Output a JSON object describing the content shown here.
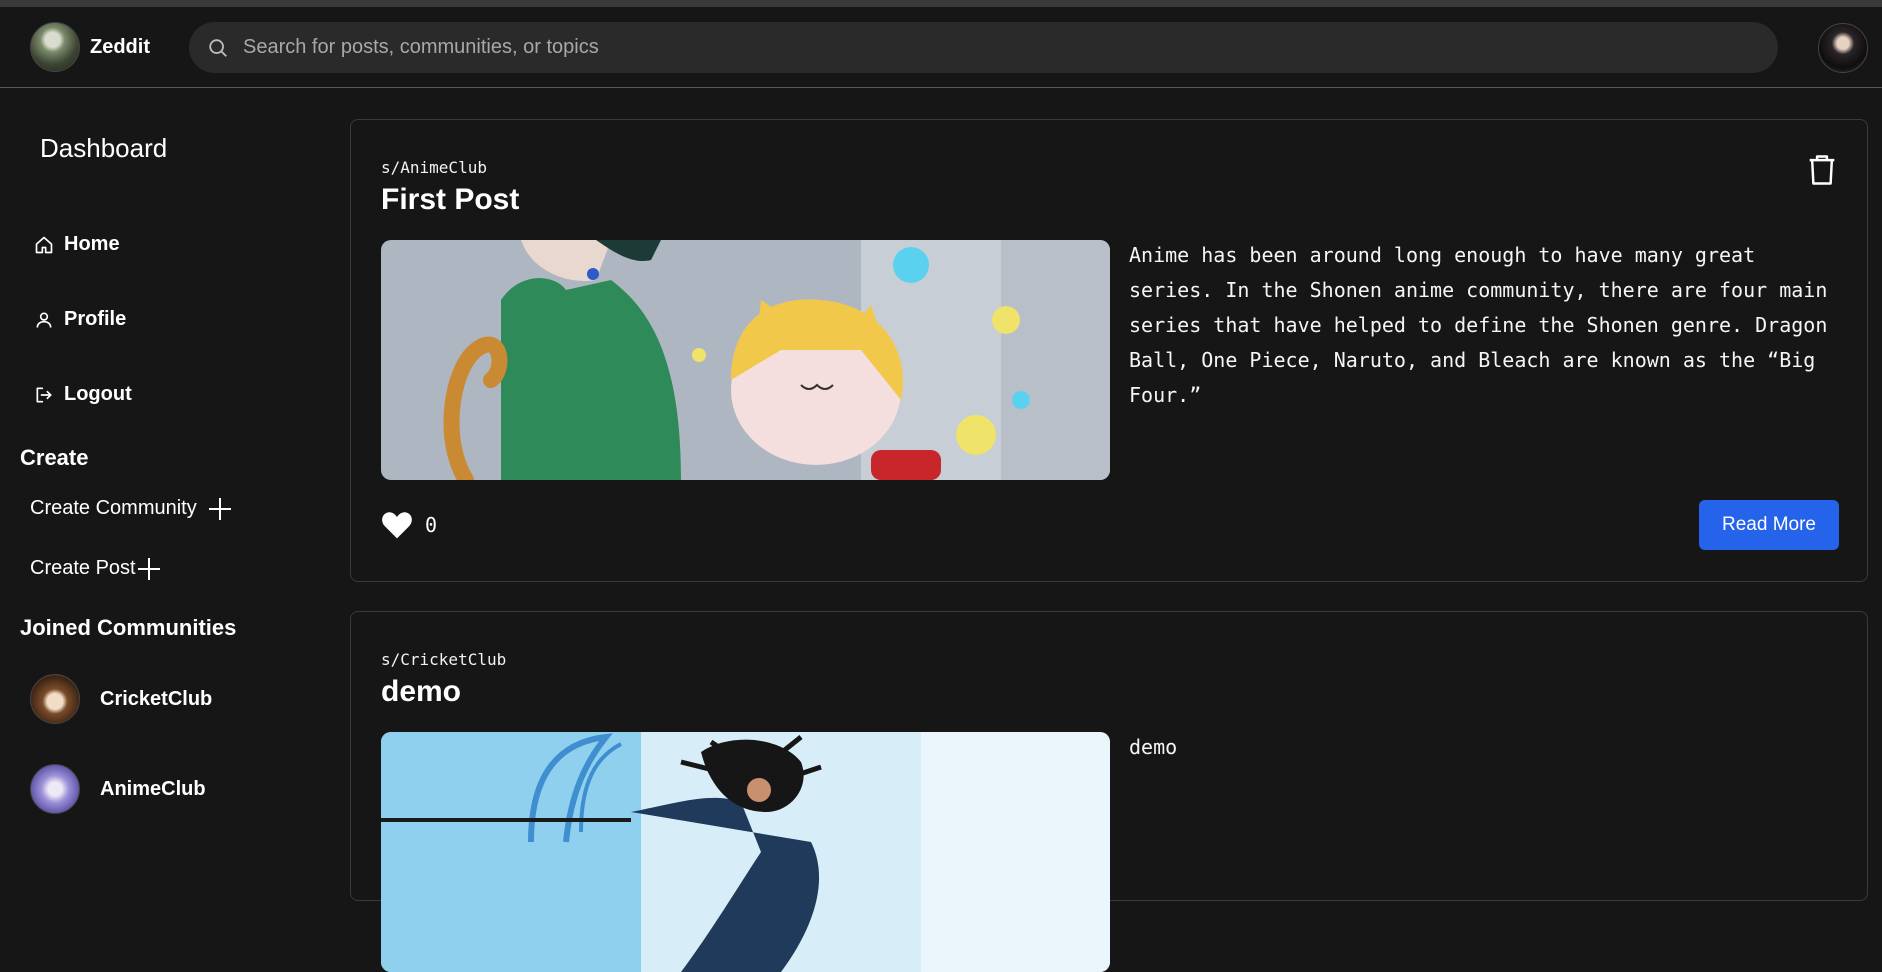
{
  "header": {
    "brand_name": "Zeddit",
    "search_placeholder": "Search for posts, communities, or topics",
    "search_icon": "search-icon"
  },
  "sidebar": {
    "title": "Dashboard",
    "nav": [
      {
        "label": "Home",
        "icon": "home-icon"
      },
      {
        "label": "Profile",
        "icon": "user-icon"
      },
      {
        "label": "Logout",
        "icon": "logout-icon"
      }
    ],
    "create_title": "Create",
    "create_items": [
      {
        "label": "Create Community",
        "icon": "plus-icon"
      },
      {
        "label": "Create Post",
        "icon": "plus-icon"
      }
    ],
    "joined_title": "Joined Communities",
    "communities": [
      {
        "name": "CricketClub"
      },
      {
        "name": "AnimeClub"
      }
    ]
  },
  "posts": [
    {
      "community": "s/AnimeClub",
      "title": "First Post",
      "body": "Anime has been around long enough to have many great series. In the Shonen anime community, there are four main series that have helped to define the Shonen genre. Dragon Ball, One Piece, Naruto, and Bleach are known as the “Big Four.”",
      "likes": "0",
      "read_more": "Read More"
    },
    {
      "community": "s/CricketClub",
      "title": "demo",
      "body": "demo"
    }
  ],
  "colors": {
    "background": "#161616",
    "accent": "#2563eb",
    "border": "#3a3a3a"
  }
}
